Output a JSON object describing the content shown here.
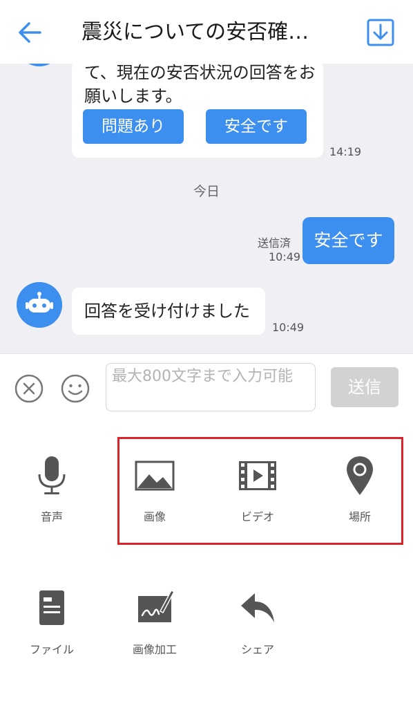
{
  "header": {
    "title": "震災についての安否確…",
    "back_icon": "arrow-left-icon",
    "download_icon": "download-icon",
    "accent_color": "#3d8fef"
  },
  "chat": {
    "messages": [
      {
        "sender": "bot",
        "text": "て、現在の安否状況の回答をお願いします。",
        "buttons": [
          "問題あり",
          "安全です"
        ],
        "time": "14:19"
      },
      {
        "sender": "me",
        "text": "安全です",
        "status": "送信済",
        "time": "10:49"
      },
      {
        "sender": "bot",
        "text": "回答を受け付けました",
        "time": "10:49"
      }
    ],
    "date_separator": "今日"
  },
  "composer": {
    "placeholder": "最大800文字まで入力可能",
    "send_label": "送信"
  },
  "attachments": [
    {
      "label": "音声",
      "icon": "microphone-icon"
    },
    {
      "label": "画像",
      "icon": "image-icon"
    },
    {
      "label": "ビデオ",
      "icon": "video-icon"
    },
    {
      "label": "場所",
      "icon": "location-pin-icon"
    },
    {
      "label": "ファイル",
      "icon": "file-icon"
    },
    {
      "label": "画像加工",
      "icon": "image-edit-icon"
    },
    {
      "label": "シェア",
      "icon": "share-icon"
    }
  ],
  "colors": {
    "highlight": "#d9252a",
    "bubble_me": "#3d8fef",
    "chat_bg": "#efeff4"
  }
}
